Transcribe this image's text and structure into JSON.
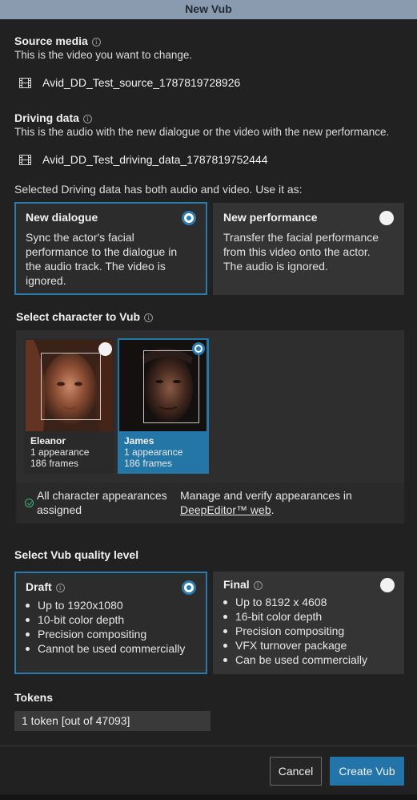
{
  "window": {
    "title": "New Vub"
  },
  "source_media": {
    "label": "Source media",
    "description": "This is the video you want to change.",
    "file_name": "Avid_DD_Test_source_1787819728926"
  },
  "driving_data": {
    "label": "Driving data",
    "description": "This is the audio with the new dialogue or the video with the new performance.",
    "file_name": "Avid_DD_Test_driving_data_1787819752444"
  },
  "usage": {
    "prompt": "Selected Driving data has both audio and video. Use it as:",
    "options": [
      {
        "title": "New dialogue",
        "description": "Sync the actor's facial performance to the dialogue in the audio track. The video is ignored.",
        "selected": true
      },
      {
        "title": "New performance",
        "description": "Transfer the facial performance from this video onto the actor. The audio is ignored.",
        "selected": false
      }
    ]
  },
  "characters": {
    "label": "Select character to Vub",
    "items": [
      {
        "name": "Eleanor",
        "appearances": "1 appearance",
        "frames": "186 frames",
        "selected": false
      },
      {
        "name": "James",
        "appearances": "1 appearance",
        "frames": "186 frames",
        "selected": true
      }
    ],
    "status": "All character appearances assigned",
    "manage_text": "Manage and verify appearances in",
    "manage_link": "DeepEditor™ web",
    "manage_suffix": "."
  },
  "quality": {
    "label": "Select Vub quality level",
    "options": [
      {
        "title": "Draft",
        "features": [
          "Up to 1920x1080",
          "10-bit color depth",
          "Precision compositing",
          "Cannot be used commercially"
        ],
        "selected": true
      },
      {
        "title": "Final",
        "features": [
          "Up to 8192 x 4608",
          "16-bit color depth",
          "Precision compositing",
          "VFX turnover package",
          "Can be used commercially"
        ],
        "selected": false
      }
    ]
  },
  "tokens": {
    "label": "Tokens",
    "value": "1 token [out of 47093]"
  },
  "actions": {
    "cancel": "Cancel",
    "create": "Create Vub"
  },
  "colors": {
    "accent": "#2b7bb1",
    "primary_button": "#2374a8",
    "titlebar": "#8a9bb0",
    "background": "#212121",
    "success": "#3fb37a"
  }
}
